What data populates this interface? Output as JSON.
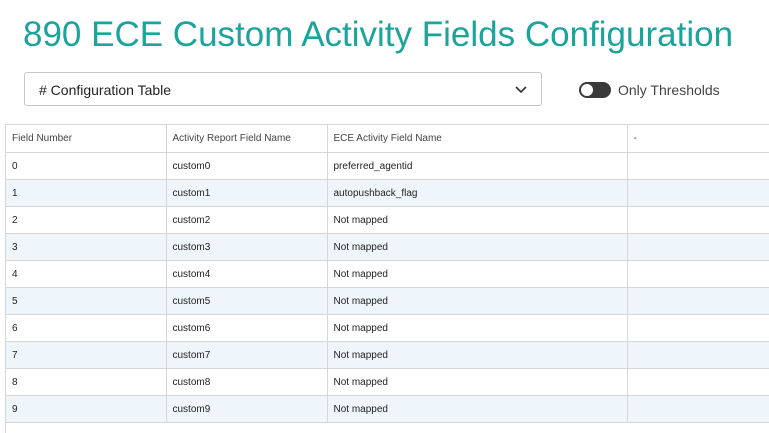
{
  "header": {
    "title": "890 ECE Custom Activity Fields Configuration"
  },
  "controls": {
    "dropdown_value": "# Configuration Table",
    "toggle_label": "Only Thresholds",
    "toggle_on": false
  },
  "table": {
    "headers": [
      "Field Number",
      "Activity Report Field Name",
      "ECE Activity Field Name",
      "-"
    ],
    "rows": [
      [
        "0",
        "custom0",
        "preferred_agentid",
        ""
      ],
      [
        "1",
        "custom1",
        "autopushback_flag",
        ""
      ],
      [
        "2",
        "custom2",
        "Not mapped",
        ""
      ],
      [
        "3",
        "custom3",
        "Not mapped",
        ""
      ],
      [
        "4",
        "custom4",
        "Not mapped",
        ""
      ],
      [
        "5",
        "custom5",
        "Not mapped",
        ""
      ],
      [
        "6",
        "custom6",
        "Not mapped",
        ""
      ],
      [
        "7",
        "custom7",
        "Not mapped",
        ""
      ],
      [
        "8",
        "custom8",
        "Not mapped",
        ""
      ],
      [
        "9",
        "custom9",
        "Not mapped",
        ""
      ]
    ]
  },
  "colors": {
    "title": "#1ba39c",
    "row_alt": "#eef6fb",
    "toggle_off": "#3a3a3a"
  },
  "icons": {
    "dropdown": "chevron-down-icon"
  }
}
